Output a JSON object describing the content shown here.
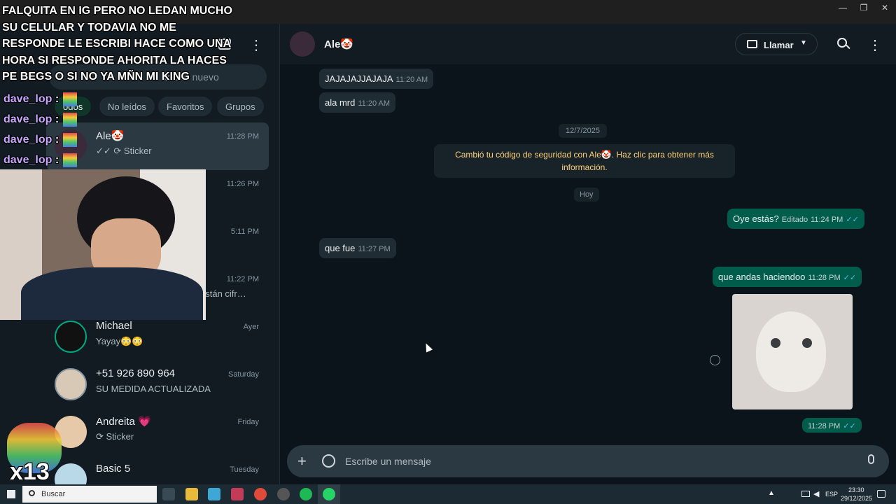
{
  "window": {
    "minimize": "—",
    "restore": "❐",
    "close": "✕"
  },
  "overlay": {
    "message_lines": [
      "FALQUITA EN IG PERO NO LEDAN MUCHO",
      "SU CELULAR Y TODAVIA NO ME",
      "RESPONDE LE ESCRIBI HACE COMO UNA",
      "HORA SI RESPONDE AHORITA LA HACES",
      "PE BEGS O SI NO YA MÑN MI KING"
    ],
    "chat_user": "dave_lop",
    "chat_sep": ":",
    "counter": "x13"
  },
  "sidebar": {
    "search_placeholder": "Busca un chat o inicia uno nuevo",
    "search_visible": "ar uno nuevo",
    "filters": [
      "Todos",
      "No leídos",
      "Favoritos",
      "Grupos"
    ],
    "filter_visible_first": "odos"
  },
  "chats": [
    {
      "name": "Ale🤡",
      "preview": "✓✓ ⟳ Sticker",
      "time": "11:28 PM",
      "selected": true
    },
    {
      "name": "",
      "preview": "",
      "time": "11:26 PM"
    },
    {
      "name": "",
      "preview": "",
      "time": "5:11 PM"
    },
    {
      "name": "",
      "preview": "están cifr…",
      "time": "11:22 PM"
    },
    {
      "name": "Michael",
      "preview": "Yayay😳😳",
      "time": "Ayer"
    },
    {
      "name": "+51 926 890 964",
      "preview": "SU MEDIDA ACTUALIZADA",
      "time": "Saturday"
    },
    {
      "name": "Andreita 💗",
      "preview": "⟳ Sticker",
      "time": "Friday"
    },
    {
      "name": "Basic 5",
      "preview": "",
      "time": "Tuesday"
    }
  ],
  "conversation": {
    "contact_name": "Ale🤡",
    "call_label": "Llamar",
    "messages_in": [
      {
        "text": "JAJAJAJJAJAJA",
        "time": "11:20 AM"
      },
      {
        "text": "ala mrd",
        "time": "11:20 AM"
      },
      {
        "text": "que fue",
        "time": "11:27 PM"
      }
    ],
    "date_divider": "12/7/2025",
    "security_notice": "Cambió tu código de seguridad con Ale🤡. Haz clic para obtener más información.",
    "today_divider": "Hoy",
    "messages_out": [
      {
        "text": "Oye estás?",
        "edited": "Editado",
        "time": "11:24 PM"
      },
      {
        "text": "que andas haciendoo",
        "time": "11:28 PM"
      }
    ],
    "sticker_time": "11:28 PM",
    "compose_placeholder": "Escribe un mensaje"
  },
  "taskbar": {
    "search_label": "Buscar",
    "lang": "ESP",
    "time": "23:30",
    "date": "29/12/2025"
  },
  "colors": {
    "accent_green": "#00a884",
    "out_bubble": "#005c4b",
    "in_bubble": "#202c33",
    "read_tick": "#53bdeb",
    "security_text": "#ffd279"
  }
}
